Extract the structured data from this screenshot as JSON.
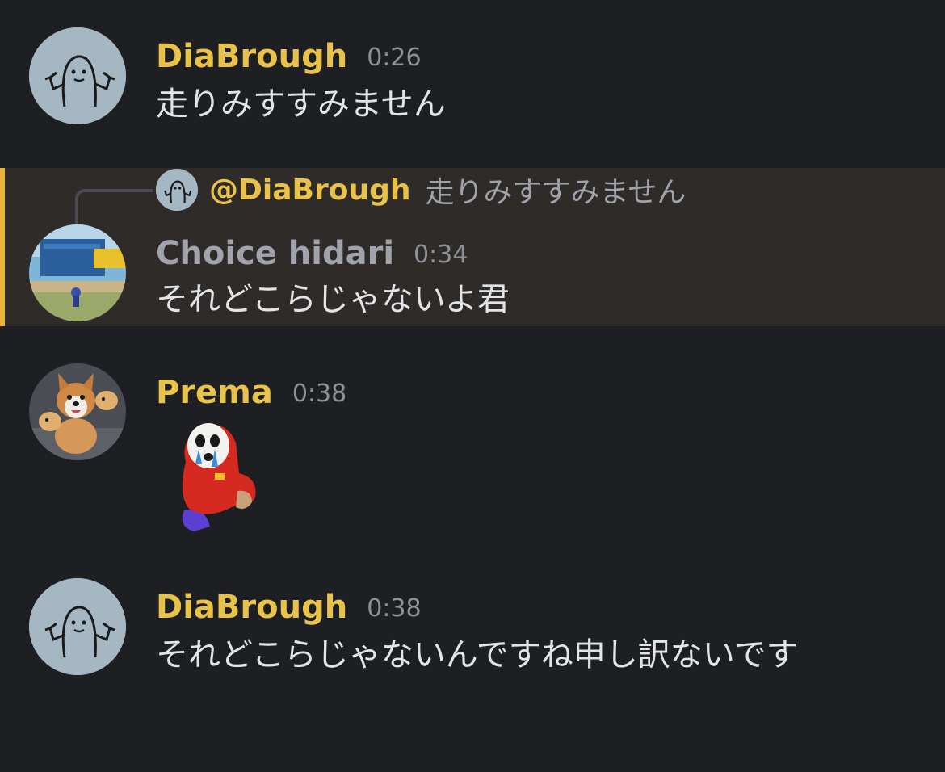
{
  "messages": [
    {
      "author": "DiaBrough",
      "author_color": "#e9c24a",
      "time": "0:26",
      "text": "走りみすすみません",
      "avatar": "muscle-doodle-avatar"
    },
    {
      "reply_to": {
        "mention": "@DiaBrough",
        "text": "走りみすすみません",
        "avatar": "muscle-doodle-avatar"
      },
      "author": "Choice hidari",
      "author_color": "#a0a3ab",
      "time": "0:34",
      "text": "それどこらじゃないよ君",
      "avatar": "game-scene-avatar",
      "highlight_color": "#e9b33a"
    },
    {
      "author": "Prema",
      "author_color": "#e9c24a",
      "time": "0:38",
      "sticker": "crying-shy-guy-sticker",
      "avatar": "corgi-avatar"
    },
    {
      "author": "DiaBrough",
      "author_color": "#e9c24a",
      "time": "0:38",
      "text": "それどこらじゃないんですね申し訳ないです",
      "avatar": "muscle-doodle-avatar"
    }
  ]
}
